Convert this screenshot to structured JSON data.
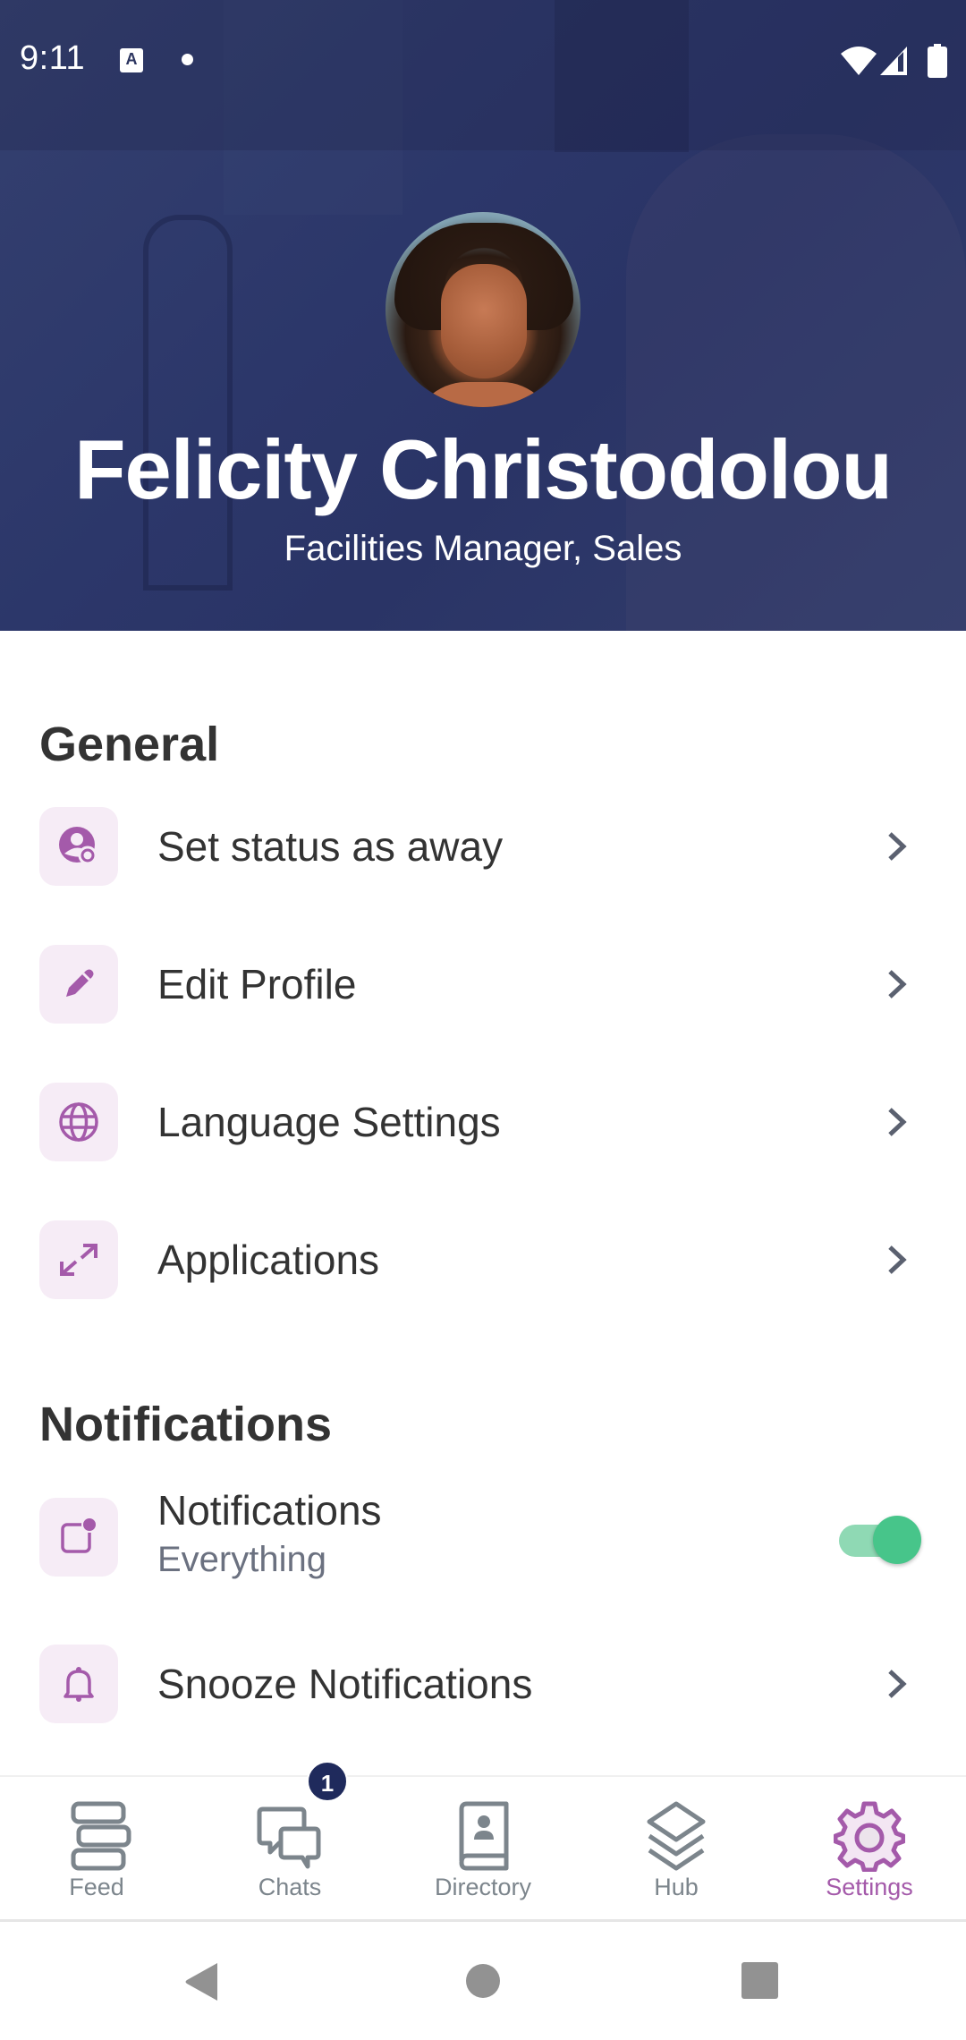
{
  "status_bar": {
    "time": "9:11",
    "notification_icon_letter": "A",
    "icons": [
      "keyboard-a-icon",
      "dot-icon",
      "wifi-icon",
      "signal-icon",
      "battery-icon"
    ]
  },
  "profile": {
    "name": "Felicity Christodolou",
    "title": "Facilities Manager, Sales"
  },
  "sections": {
    "general": {
      "title": "General",
      "items": [
        {
          "label": "Set status as away",
          "icon": "user-away-icon"
        },
        {
          "label": "Edit Profile",
          "icon": "pencil-icon"
        },
        {
          "label": "Language Settings",
          "icon": "globe-icon"
        },
        {
          "label": "Applications",
          "icon": "expand-arrows-icon"
        }
      ]
    },
    "notifications": {
      "title": "Notifications",
      "items": [
        {
          "label": "Notifications",
          "sublabel": "Everything",
          "icon": "notification-icon",
          "toggle_on": true
        },
        {
          "label": "Snooze Notifications",
          "icon": "bell-icon"
        }
      ]
    }
  },
  "bottom_nav": {
    "items": [
      {
        "label": "Feed",
        "icon": "feed-icon",
        "active": false
      },
      {
        "label": "Chats",
        "icon": "chats-icon",
        "active": false,
        "badge": "1"
      },
      {
        "label": "Directory",
        "icon": "directory-icon",
        "active": false
      },
      {
        "label": "Hub",
        "icon": "layers-icon",
        "active": false
      },
      {
        "label": "Settings",
        "icon": "gear-icon",
        "active": true
      }
    ]
  },
  "colors": {
    "accent": "#a45aaa",
    "icon_tile_bg": "#f6ecf6",
    "header_bg": "#2f3a6b",
    "badge_bg": "#1f2a5c",
    "toggle_on": "#47c58a",
    "nav_inactive": "#7c858c"
  }
}
